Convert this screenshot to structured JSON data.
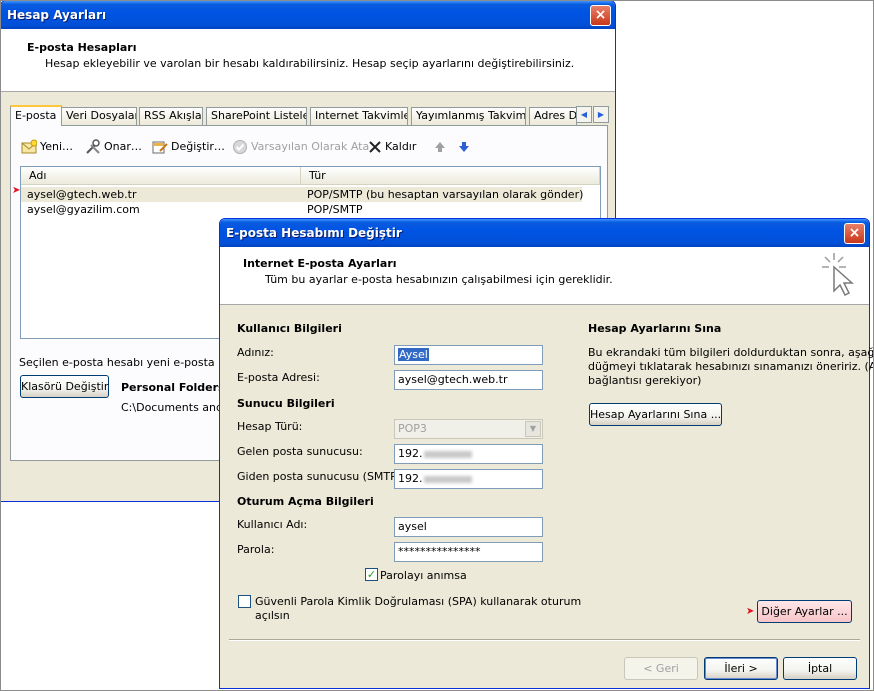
{
  "account_settings": {
    "title": "Hesap Ayarları",
    "close": "×",
    "header_title": "E-posta Hesapları",
    "header_desc": "Hesap ekleyebilir ve varolan bir hesabı kaldırabilirsiniz. Hesap seçip ayarlarını değiştirebilirsiniz.",
    "tabs": [
      "E-posta",
      "Veri Dosyaları",
      "RSS Akışları",
      "SharePoint Listeleri",
      "Internet Takvimleri",
      "Yayımlanmış Takvimler",
      "Adres Def"
    ],
    "toolbar": {
      "new": "Yeni…",
      "repair": "Onar…",
      "change": "Değiştir…",
      "set_default": "Varsayılan Olarak Ata",
      "remove": "Kaldır"
    },
    "columns": {
      "name": "Adı",
      "type": "Tür"
    },
    "accounts": [
      {
        "name": "aysel@gtech.web.tr",
        "type": "POP/SMTP (bu hesaptan varsayılan olarak gönder)"
      },
      {
        "name": "aysel@gyazilim.com",
        "type": "POP/SMTP"
      }
    ],
    "bottom_text": "Seçilen e-posta hesabı yeni e-posta iletiler",
    "change_folder": "Klasörü Değiştir",
    "folder_name": "Personal Folders\\",
    "folder_path": "C:\\Documents and S"
  },
  "change_account": {
    "title": "E-posta Hesabımı Değiştir",
    "close": "×",
    "header_title": "Internet E-posta Ayarları",
    "header_desc": "Tüm bu ayarlar e-posta hesabınızın çalışabilmesi için gereklidir.",
    "user_info_title": "Kullanıcı Bilgileri",
    "name_label": "Adınız:",
    "name_value": "Aysel",
    "email_label": "E-posta Adresi:",
    "email_value": "aysel@gtech.web.tr",
    "server_info_title": "Sunucu Bilgileri",
    "account_type_label": "Hesap Türü:",
    "account_type_value": "POP3",
    "incoming_label": "Gelen posta sunucusu:",
    "incoming_value": "192.",
    "outgoing_label": "Giden posta sunucusu (SMTP):",
    "outgoing_value": "192.",
    "logon_title": "Oturum Açma Bilgileri",
    "username_label": "Kullanıcı Adı:",
    "username_value": "aysel",
    "password_label": "Parola:",
    "password_value": "***************",
    "remember_password": "Parolayı anımsa",
    "remember_checked": true,
    "spa_label_1": "Güvenli Parola Kimlik Doğrulaması (SPA) kullanarak oturum",
    "spa_label_2": "açılsın",
    "spa_checked": false,
    "test_title": "Hesap Ayarlarını Sına",
    "test_desc_1": "Bu ekrandaki tüm bilgileri doldurduktan sonra, aşağıdaki",
    "test_desc_2": "düğmeyi tıklatarak hesabınızı sınamanızı öneririz. (Ağ",
    "test_desc_3": "bağlantısı gerekiyor)",
    "test_button": "Hesap Ayarlarını Sına ...",
    "more_settings": "Diğer Ayarlar ...",
    "back": "< Geri",
    "next": "İleri >",
    "cancel": "İptal"
  },
  "colors": {
    "titlebar": "#0054e3",
    "dialog_bg": "#ece9d8",
    "marker": "#e0141e",
    "selection": "#316ac5"
  }
}
